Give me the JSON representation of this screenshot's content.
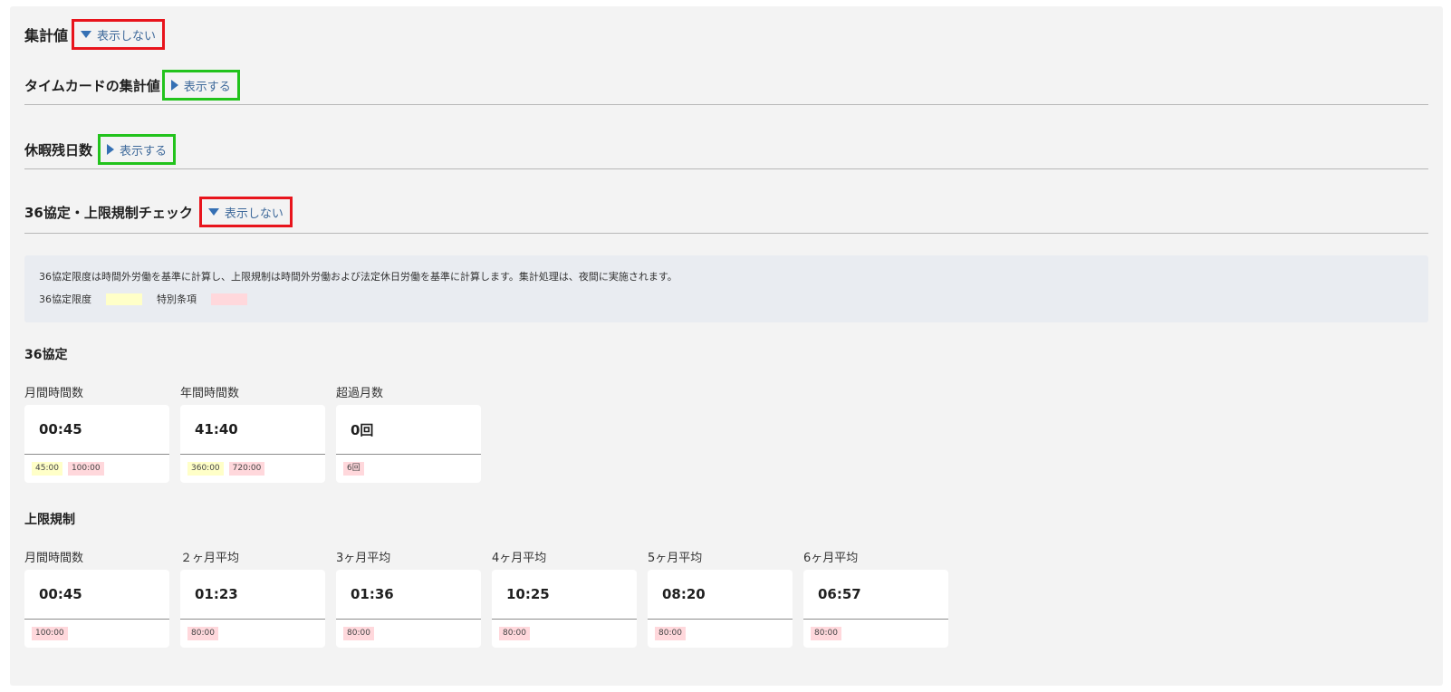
{
  "sections": {
    "summary": {
      "title": "集計値",
      "toggle": "表示しない"
    },
    "timecard": {
      "title": "タイムカードの集計値",
      "toggle": "表示する"
    },
    "leave": {
      "title": "休暇残日数",
      "toggle": "表示する"
    },
    "check36": {
      "title": "36協定・上限規制チェック",
      "toggle": "表示しない"
    }
  },
  "info": {
    "text": "36協定限度は時間外労働を基準に計算し、上限規制は時間外労働および法定休日労働を基準に計算します。集計処理は、夜間に実施されます。",
    "legend_limit": "36協定限度",
    "legend_special": "特別条項",
    "colors": {
      "limit": "#ffffc8",
      "special": "#ffd8dc"
    }
  },
  "agreement36": {
    "title": "36協定",
    "cards": [
      {
        "label": "月間時間数",
        "value": "00:45",
        "chips": [
          {
            "text": "45:00",
            "kind": "yellow"
          },
          {
            "text": "100:00",
            "kind": "pink"
          }
        ]
      },
      {
        "label": "年間時間数",
        "value": "41:40",
        "chips": [
          {
            "text": "360:00",
            "kind": "yellow"
          },
          {
            "text": "720:00",
            "kind": "pink"
          }
        ]
      },
      {
        "label": "超過月数",
        "value": "0回",
        "chips": [
          {
            "text": "6回",
            "kind": "pink"
          }
        ]
      }
    ]
  },
  "upperLimit": {
    "title": "上限規制",
    "cards": [
      {
        "label": "月間時間数",
        "value": "00:45",
        "chips": [
          {
            "text": "100:00",
            "kind": "pink"
          }
        ]
      },
      {
        "label": "２ヶ月平均",
        "value": "01:23",
        "chips": [
          {
            "text": "80:00",
            "kind": "pink"
          }
        ]
      },
      {
        "label": "3ヶ月平均",
        "value": "01:36",
        "chips": [
          {
            "text": "80:00",
            "kind": "pink"
          }
        ]
      },
      {
        "label": "4ヶ月平均",
        "value": "10:25",
        "chips": [
          {
            "text": "80:00",
            "kind": "pink"
          }
        ]
      },
      {
        "label": "5ヶ月平均",
        "value": "08:20",
        "chips": [
          {
            "text": "80:00",
            "kind": "pink"
          }
        ]
      },
      {
        "label": "6ヶ月平均",
        "value": "06:57",
        "chips": [
          {
            "text": "80:00",
            "kind": "pink"
          }
        ]
      }
    ]
  }
}
